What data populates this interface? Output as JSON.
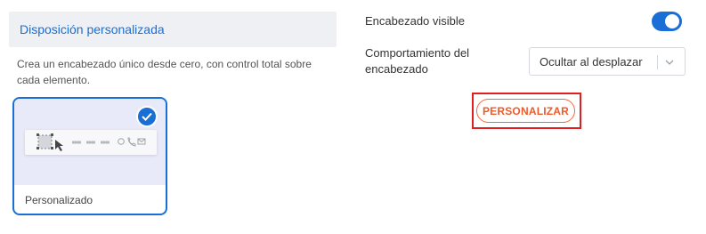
{
  "layout_section": {
    "title": "Disposición personalizada",
    "description": "Crea un encabezado único desde cero, con control total sobre cada elemento.",
    "card": {
      "label": "Personalizado",
      "selected": true
    }
  },
  "settings": {
    "header_visible": {
      "label": "Encabezado visible",
      "enabled": true
    },
    "header_behavior": {
      "label": "Comportamiento del encabezado",
      "value": "Ocultar al desplazar"
    },
    "customize_button": "PERSONALIZAR"
  },
  "colors": {
    "accent": "#1a6fd6",
    "button": "#f05a28",
    "highlight": "#e02020"
  }
}
